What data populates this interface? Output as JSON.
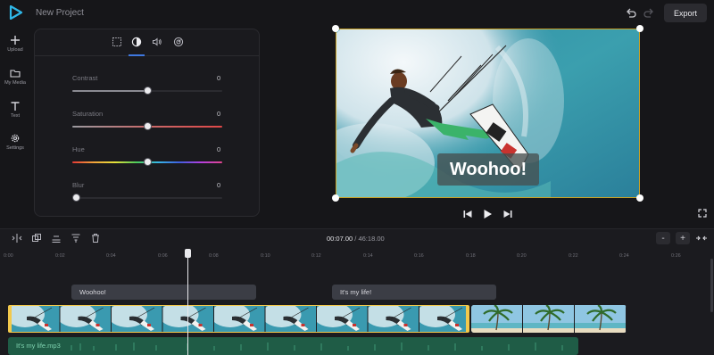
{
  "header": {
    "project_title": "New Project",
    "export_label": "Export"
  },
  "sidebar": {
    "items": [
      {
        "label": "Upload",
        "icon": "plus-icon"
      },
      {
        "label": "My Media",
        "icon": "folder-icon"
      },
      {
        "label": "Text",
        "icon": "text-icon"
      },
      {
        "label": "Settings",
        "icon": "gear-icon"
      }
    ]
  },
  "adjust_panel": {
    "tabs": [
      "crop-icon",
      "contrast-icon",
      "volume-icon",
      "speed-icon"
    ],
    "active_tab": "contrast-icon",
    "sliders": [
      {
        "label": "Contrast",
        "value": "0",
        "level": 0.5
      },
      {
        "label": "Saturation",
        "value": "0",
        "level": 0.5
      },
      {
        "label": "Hue",
        "value": "0",
        "level": 0.5
      },
      {
        "label": "Blur",
        "value": "0",
        "level": 0.0
      }
    ]
  },
  "preview": {
    "caption": "Woohoo!",
    "accent": "#c9a227"
  },
  "playback": {
    "controls": [
      "skip-back-icon",
      "play-icon",
      "skip-forward-icon"
    ]
  },
  "timeline": {
    "current_time": "00:07.00",
    "separator": " / ",
    "total_time": "46:18.00",
    "zoom": [
      "-",
      "+"
    ],
    "ruler": [
      "0:00",
      "0:02",
      "0:04",
      "0:06",
      "0:08",
      "0:10",
      "0:12",
      "0:14",
      "0:16",
      "0:18",
      "0:20",
      "0:22",
      "0:24",
      "0:26"
    ],
    "text_clips": [
      "Woohoo!",
      "It's my life!"
    ],
    "audio_clip": "It's my life.mp3",
    "colors": {
      "video_border": "#f2c94c",
      "audio": "#1f5c46"
    }
  }
}
